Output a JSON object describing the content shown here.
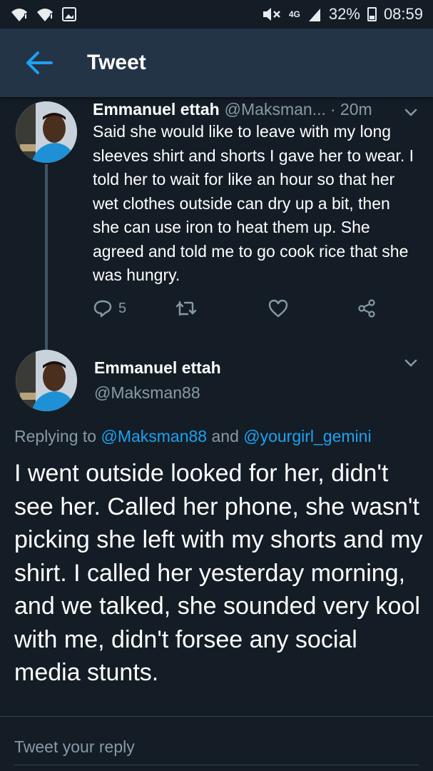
{
  "status_bar": {
    "network": "4G",
    "battery": "32%",
    "time": "08:59"
  },
  "header": {
    "title": "Tweet",
    "back_icon": "arrow-left-icon"
  },
  "tweet1": {
    "name": "Emmanuel ettah",
    "handle": "@Maksman...",
    "time": "· 20m",
    "text": "Said she would like to leave with my long sleeves shirt and shorts I gave her to wear. I told her to wait for like an hour so that her wet clothes outside can dry up a bit, then she can use iron to heat them up. She agreed and told me to go cook rice that she was hungry.",
    "reply_count": "5"
  },
  "tweet2": {
    "name": "Emmanuel ettah",
    "handle": "@Maksman88",
    "replying_prefix": "Replying to",
    "replying_user1": "@Maksman88",
    "replying_and": "and",
    "replying_user2": "@yourgirl_gemini",
    "text": "I went outside looked for her, didn't see her. Called her phone, she wasn't picking she left with my shorts and my shirt. I called her yesterday morning, and we talked, she sounded very kool with me, didn't forsee any social media stunts."
  },
  "reply_bar": {
    "placeholder": "Tweet your reply"
  },
  "colors": {
    "background": "#141d26",
    "app_bar": "#243447",
    "accent": "#1da1f2",
    "secondary_text": "#8899a6"
  }
}
